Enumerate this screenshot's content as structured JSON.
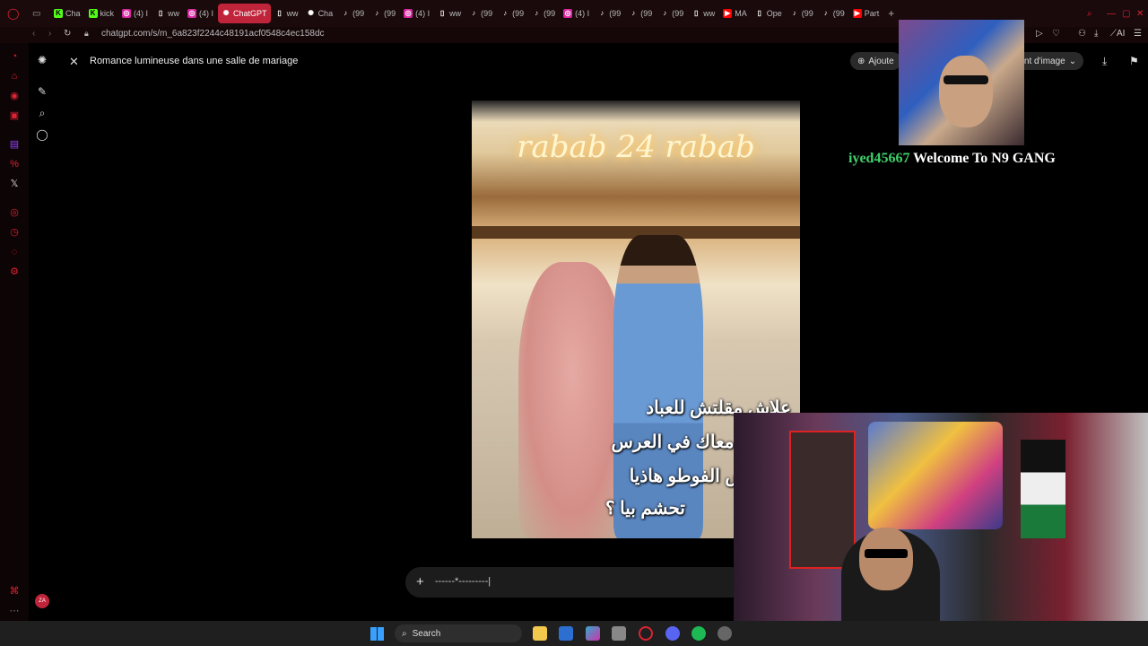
{
  "browser": {
    "tabs": [
      {
        "label": "Cha",
        "icon": "kick-icon",
        "color": "#53fc18"
      },
      {
        "label": "kick",
        "icon": "kick-icon",
        "color": "#53fc18"
      },
      {
        "label": "(4) I",
        "icon": "instagram-icon",
        "color": "#d6249f"
      },
      {
        "label": "ww",
        "icon": "page-icon",
        "color": "#888888"
      },
      {
        "label": "(4) I",
        "icon": "instagram-icon",
        "color": "#d6249f"
      },
      {
        "label": "ChatGPT",
        "icon": "chatgpt-icon",
        "color": "#ffffff",
        "active": true
      },
      {
        "label": "ww",
        "icon": "page-icon",
        "color": "#888888"
      },
      {
        "label": "Cha",
        "icon": "chatgpt-icon",
        "color": "#ffffff"
      },
      {
        "label": "(99",
        "icon": "tiktok-icon",
        "color": "#ffffff"
      },
      {
        "label": "(99",
        "icon": "tiktok-icon",
        "color": "#ffffff"
      },
      {
        "label": "(4) I",
        "icon": "instagram-icon",
        "color": "#d6249f"
      },
      {
        "label": "ww",
        "icon": "page-icon",
        "color": "#888888"
      },
      {
        "label": "(99",
        "icon": "tiktok-icon",
        "color": "#ffffff"
      },
      {
        "label": "(99",
        "icon": "tiktok-icon",
        "color": "#ffffff"
      },
      {
        "label": "(99",
        "icon": "tiktok-icon",
        "color": "#ffffff"
      },
      {
        "label": "(4) I",
        "icon": "instagram-icon",
        "color": "#d6249f"
      },
      {
        "label": "(99",
        "icon": "tiktok-icon",
        "color": "#ffffff"
      },
      {
        "label": "(99",
        "icon": "tiktok-icon",
        "color": "#ffffff"
      },
      {
        "label": "(99",
        "icon": "tiktok-icon",
        "color": "#ffffff"
      },
      {
        "label": "ww",
        "icon": "page-icon",
        "color": "#888888"
      },
      {
        "label": "MA",
        "icon": "youtube-icon",
        "color": "#ff0000"
      },
      {
        "label": "Ope",
        "icon": "page-icon",
        "color": "#d23"
      },
      {
        "label": "(99",
        "icon": "tiktok-icon",
        "color": "#ffffff"
      },
      {
        "label": "(99",
        "icon": "tiktok-icon",
        "color": "#ffffff"
      },
      {
        "label": "Part",
        "icon": "youtube-icon",
        "color": "#ff0000"
      }
    ],
    "url": "chatgpt.com/s/m_6a823f2244c48191acf0548c4ec158dc"
  },
  "chatgpt": {
    "title": "Romance lumineuse dans une salle de mariage",
    "add_button": "Ajoute",
    "format_button": "ment d'image",
    "image": {
      "caption_title": "rabab 24 rabab",
      "overlay_lines": [
        "علاش مقلتش للعباد",
        "انا كنت معاك في العرس",
        "ومبعتتش الفوطو هاذيا",
        "تحشم بيا ؟"
      ]
    },
    "input_text": "------*---------|"
  },
  "stream": {
    "chat_user": "iyed45667",
    "chat_message": "Welcome To N9 GANG"
  },
  "taskbar": {
    "search_label": "Search"
  }
}
